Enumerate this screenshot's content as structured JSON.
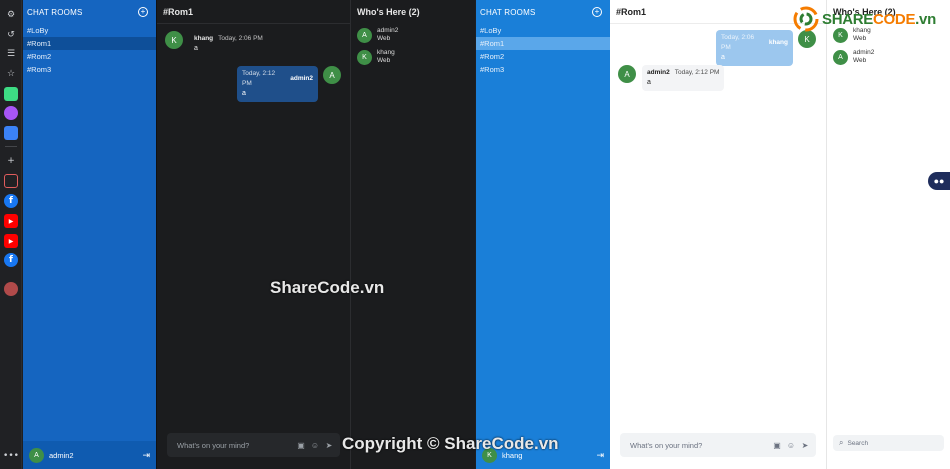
{
  "rail_icons": [
    "gear-icon",
    "history-icon",
    "list-icon",
    "star-icon",
    "app-icon",
    "messenger-icon",
    "chat-icon",
    "plus-icon",
    "square-app-icon",
    "facebook-icon",
    "youtube-icon",
    "youtube-icon",
    "facebook-icon",
    "photo-icon",
    "more-icon"
  ],
  "dark": {
    "sidebar": {
      "title": "CHAT ROOMS",
      "rooms": [
        "#LoBy",
        "#Rom1",
        "#Rom2",
        "#Rom3"
      ],
      "user": {
        "initial": "A",
        "name": "admin2"
      }
    },
    "main": {
      "title": "#Rom1",
      "messages": [
        {
          "initial": "K",
          "name": "khang",
          "time": "Today, 2:06 PM",
          "text": "a"
        },
        {
          "initial": "A",
          "name": "admin2",
          "time": "Today, 2:12 PM",
          "text": "a"
        }
      ],
      "composer_placeholder": "What's on your mind?"
    },
    "who": {
      "title": "Who's Here (2)",
      "members": [
        {
          "initial": "A",
          "name": "admin2",
          "status": "Web"
        },
        {
          "initial": "K",
          "name": "khang",
          "status": "Web"
        }
      ]
    }
  },
  "light": {
    "sidebar": {
      "title": "CHAT ROOMS",
      "rooms": [
        "#LoBy",
        "#Rom1",
        "#Rom2",
        "#Rom3"
      ],
      "user": {
        "initial": "K",
        "name": "khang"
      }
    },
    "main": {
      "title": "#Rom1",
      "messages": [
        {
          "initial": "K",
          "name": "khang",
          "time": "Today, 2:06 PM",
          "text": "a"
        },
        {
          "initial": "A",
          "name": "admin2",
          "time": "Today, 2:12 PM",
          "text": "a"
        }
      ],
      "composer_placeholder": "What's on your mind?"
    },
    "who": {
      "title": "Who's Here (2)",
      "members": [
        {
          "initial": "K",
          "name": "khang",
          "status": "Web"
        },
        {
          "initial": "A",
          "name": "admin2",
          "status": "Web"
        }
      ],
      "search_placeholder": "Search"
    }
  },
  "watermark": {
    "center": "ShareCode.vn",
    "bottom": "Copyright © ShareCode.vn",
    "logo_a": "SHARE",
    "logo_b": "CODE",
    "logo_c": ".vn"
  },
  "colors": {
    "dark_sidebar": "#1565c0",
    "light_sidebar": "#1a7fd8",
    "avatar": "#3f8f47",
    "own_bubble_dark": "#1f4f8a",
    "own_bubble_light": "#9cc7ee"
  }
}
